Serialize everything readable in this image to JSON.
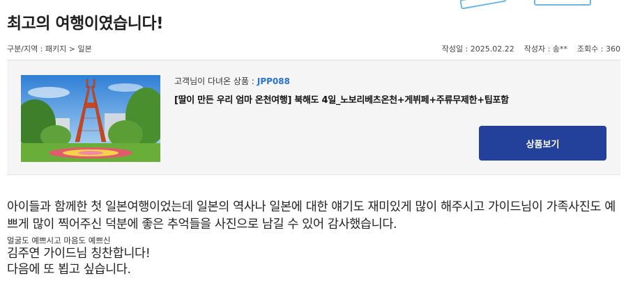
{
  "page": {
    "title": "최고의 여행이였습니다!"
  },
  "meta": {
    "category": "구분/지역 : 패키지 > 일본",
    "date": "작성일 : 2025.02.22",
    "author": "작성자 : 송**",
    "views": "조회수 : 360"
  },
  "product": {
    "label": "고객님이 다녀온 상품 :",
    "code": "JPP088",
    "name": "[딸이 만든 우리 엄마 온천여행] 북해도 4일_노보리베츠온천+게뷔페+주류무제한+팁포함",
    "view_button": "상품보기",
    "image_icon": "sapporo-tv-tower-photo"
  },
  "review": {
    "paragraph1": "아이들과 함께한 첫 일본여행이었는데 일본의 역사나  일본에 대한 얘기도 재미있게 많이 해주시고 가이드님이 가족사진도 예쁘게 많이 찍어주신 덕분에 좋은 추억들을 사진으로 남길 수 있어 감사했습니다.",
    "small_line": "얼굴도 예쁘시고 마음도 예쁘신",
    "line1": "김주연 가이드님 칭찬합니다!",
    "line2": "다음에 또 뵙고 싶습니다."
  },
  "colors": {
    "button": "#23409a",
    "code": "#2a73d0",
    "box_bg": "#f5f5f5"
  }
}
